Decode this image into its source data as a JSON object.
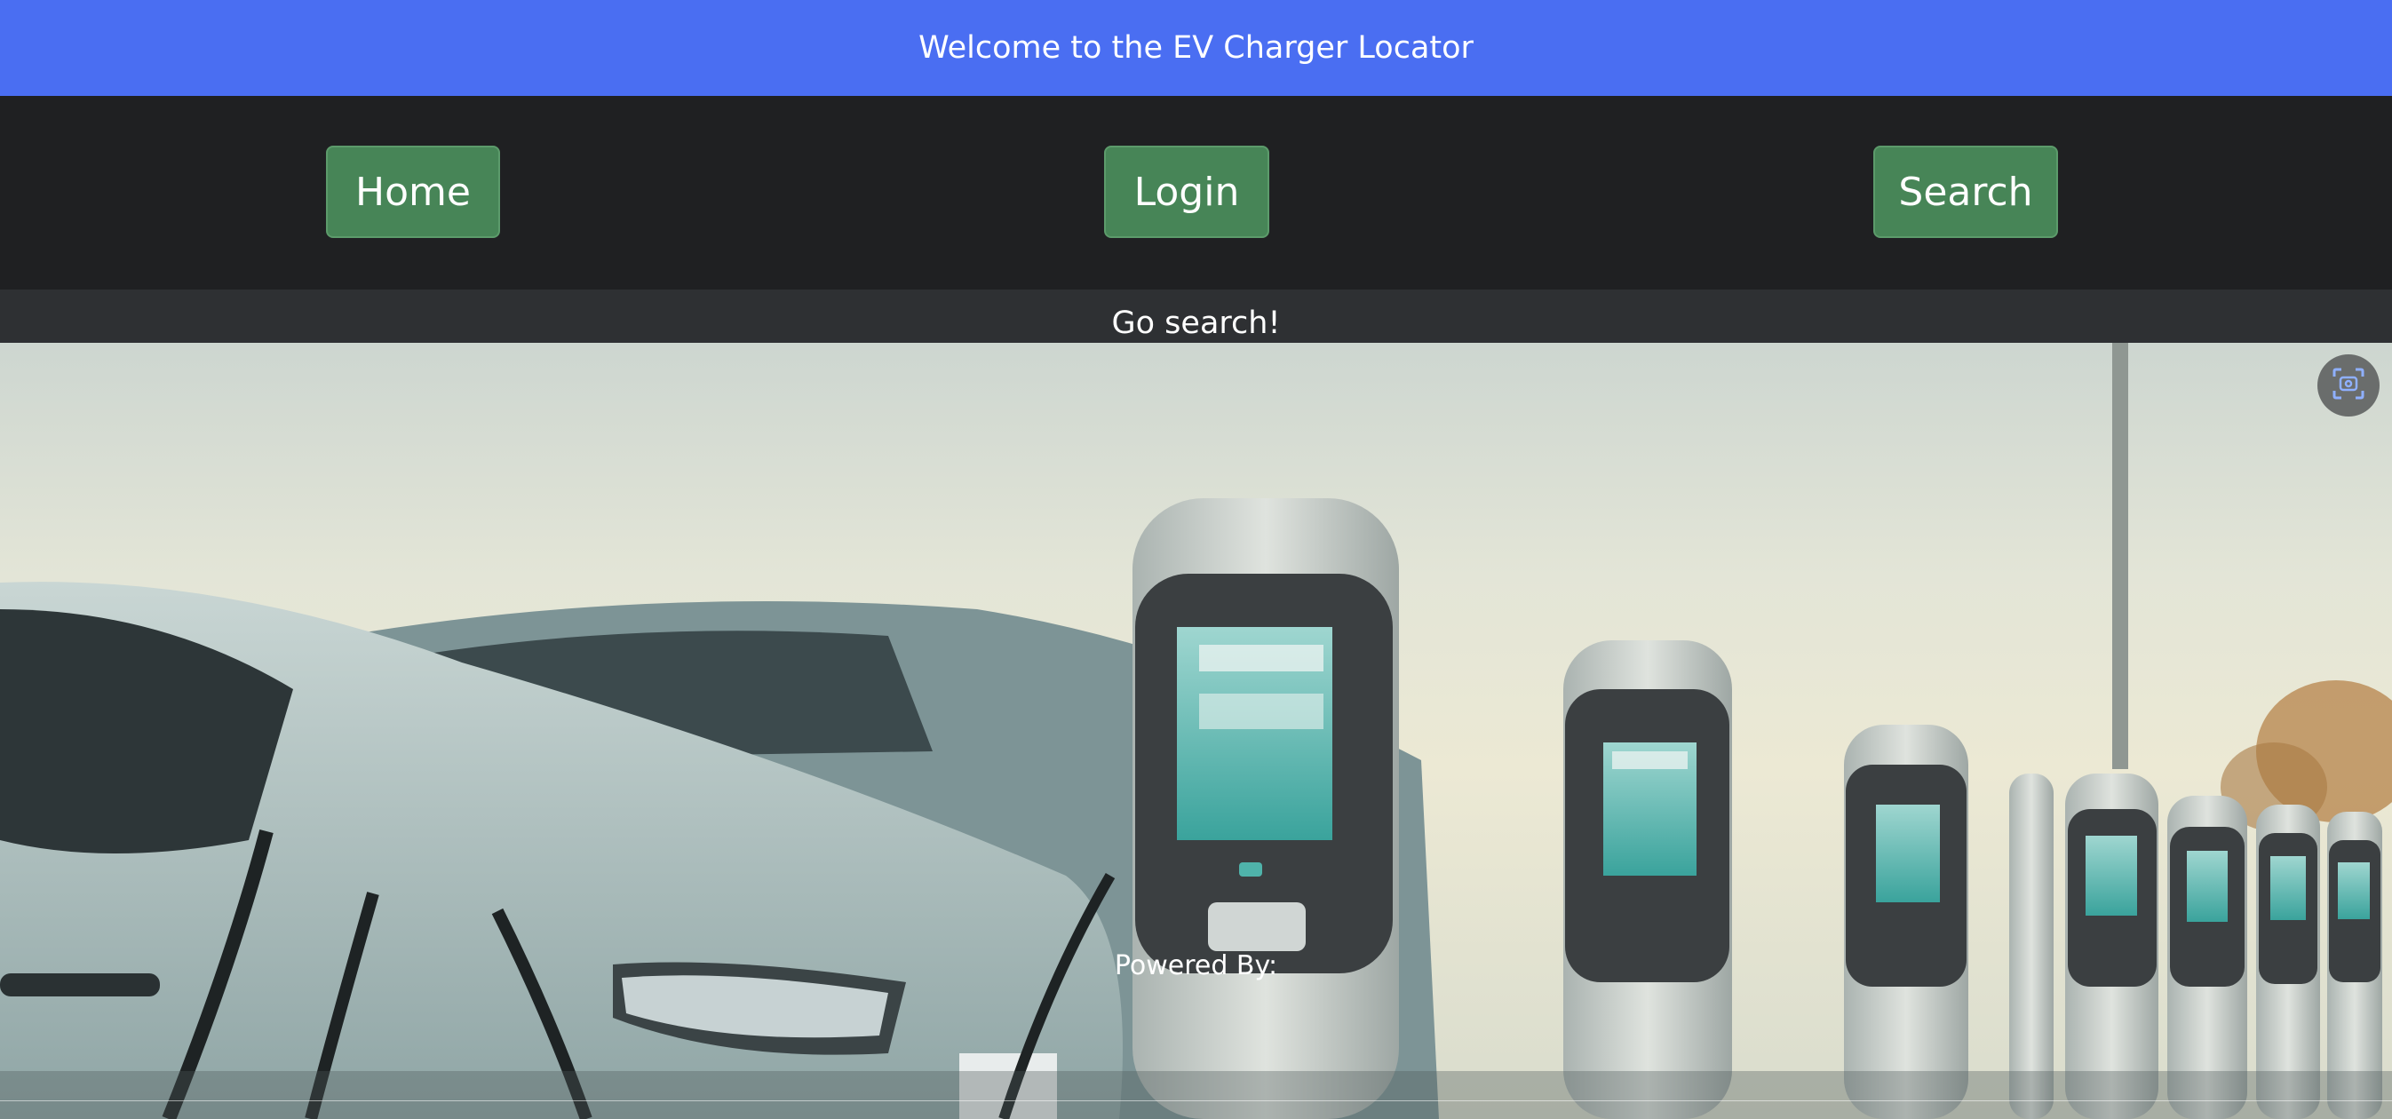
{
  "banner": {
    "text": "Welcome to the EV Charger Locator"
  },
  "nav": {
    "home_label": "Home",
    "login_label": "Login",
    "search_label": "Search"
  },
  "subbar": {
    "text": "Go search!"
  },
  "hero": {
    "powered_by": "Powered By:",
    "image_subject": "electric cars at charging stations"
  },
  "floating": {
    "icon": "screen-capture-icon"
  },
  "colors": {
    "banner_bg": "#4a6ef2",
    "nav_bg": "#1f2022",
    "button_bg": "#478557",
    "subbar_bg": "#2e3033"
  }
}
